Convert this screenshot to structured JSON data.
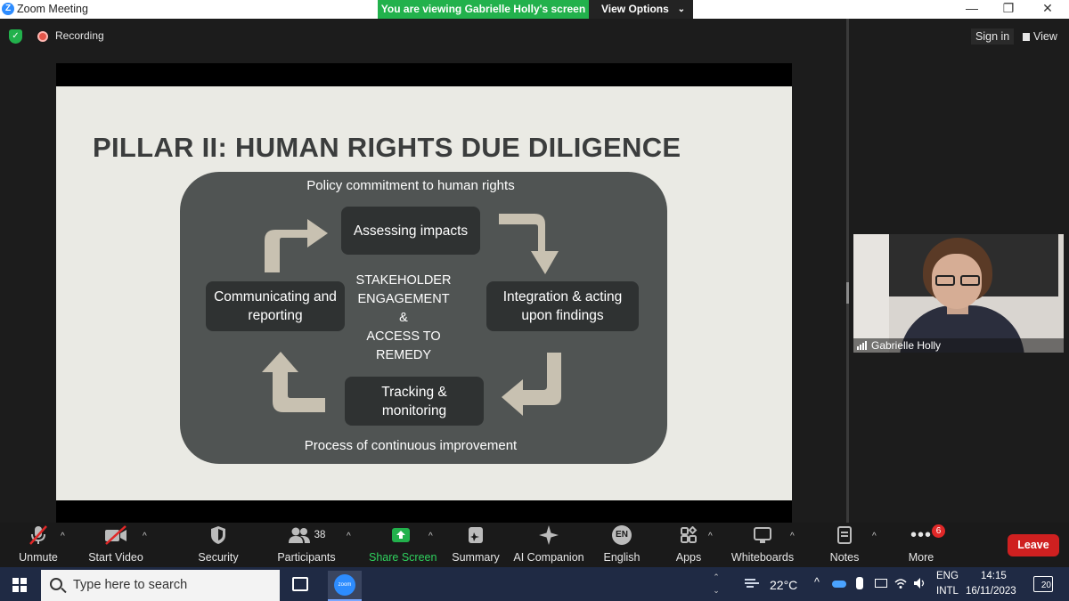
{
  "window": {
    "title": "Zoom Meeting",
    "share_banner": "You are viewing Gabrielle Holly's screen",
    "view_options": "View Options",
    "controls": [
      "—",
      "❐",
      "✕"
    ]
  },
  "status": {
    "recording_label": "Recording",
    "sign_in": "Sign in",
    "view_label": "View"
  },
  "slide": {
    "title": "PILLAR II: HUMAN RIGHTS DUE DILIGENCE",
    "top_text": "Policy commitment to human rights",
    "bottom_text": "Process of continuous improvement",
    "boxes": {
      "assessing": "Assessing impacts",
      "integration_1": "Integration & acting",
      "integration_2": "upon findings",
      "tracking_1": "Tracking &",
      "tracking_2": "monitoring",
      "communicating_1": "Communicating and",
      "communicating_2": "reporting"
    },
    "center": [
      "STAKEHOLDER",
      "ENGAGEMENT",
      "&",
      "ACCESS TO",
      "REMEDY"
    ]
  },
  "participant": {
    "name": "Gabrielle Holly"
  },
  "toolbar": {
    "unmute": "Unmute",
    "start_video": "Start Video",
    "security": "Security",
    "participants": "Participants",
    "participants_count": "38",
    "share_screen": "Share Screen",
    "summary": "Summary",
    "ai_companion": "AI Companion",
    "english": "English",
    "english_badge": "EN",
    "apps": "Apps",
    "whiteboards": "Whiteboards",
    "notes": "Notes",
    "more": "More",
    "more_badge": "6",
    "leave": "Leave"
  },
  "taskbar": {
    "search_placeholder": "Type here to search",
    "temperature": "22°C",
    "lang_1": "ENG",
    "lang_2": "INTL",
    "time": "14:15",
    "date": "16/11/2023",
    "notifications": "20"
  },
  "colors": {
    "share_green": "#22b14c",
    "leave_red": "#cf2020",
    "panel_gray": "#505453",
    "box_dark": "#2f3232",
    "arrow_beige": "#c8c1b1"
  }
}
